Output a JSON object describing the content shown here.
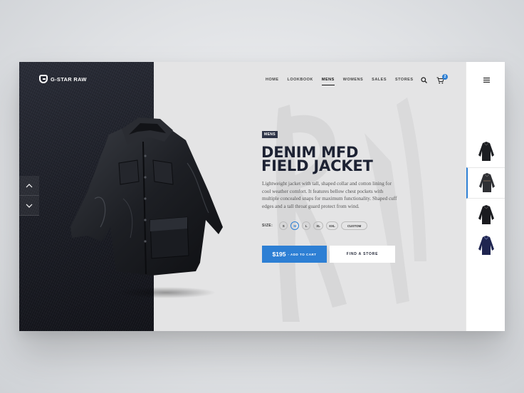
{
  "brand": {
    "logo_text": "G-STAR RAW"
  },
  "nav": {
    "items": [
      {
        "label": "HOME",
        "active": false
      },
      {
        "label": "LOOKBOOK",
        "active": false
      },
      {
        "label": "MENS",
        "active": true
      },
      {
        "label": "WOMENS",
        "active": false
      },
      {
        "label": "SALES",
        "active": false
      },
      {
        "label": "STORES",
        "active": false
      }
    ],
    "cart_count": "2"
  },
  "product": {
    "category_tag": "MENS",
    "title_line1": "DENIM MFD",
    "title_line2": "FIELD JACKET",
    "description": "Lightweight jacket with tall, shaped collar and cotton lining for cool weather comfort. It features bellow chest pockets with multiple concealed snaps for maximum functionality. Shaped cuff edges and a tall throat guard protect from wind.",
    "size_label": "SIZE:",
    "sizes": [
      "S",
      "M",
      "L",
      "XL",
      "XXL",
      "CUSTOM"
    ],
    "selected_size": "M",
    "price": "$195",
    "add_to_cart_label": "- ADD TO CART",
    "find_store_label": "FIND A STORE"
  },
  "thumbnails": [
    {
      "color": "#1c1e22",
      "active": false
    },
    {
      "color": "#2e2f33",
      "active": true
    },
    {
      "color": "#1a1b1f",
      "active": false
    },
    {
      "color": "#1f2550",
      "active": false
    }
  ],
  "colors": {
    "accent": "#2d7fd4",
    "navy": "#1d2233"
  },
  "icons": [
    "g-star-logo-icon",
    "chevron-up-icon",
    "chevron-down-icon",
    "search-icon",
    "cart-icon",
    "hamburger-menu-icon"
  ]
}
